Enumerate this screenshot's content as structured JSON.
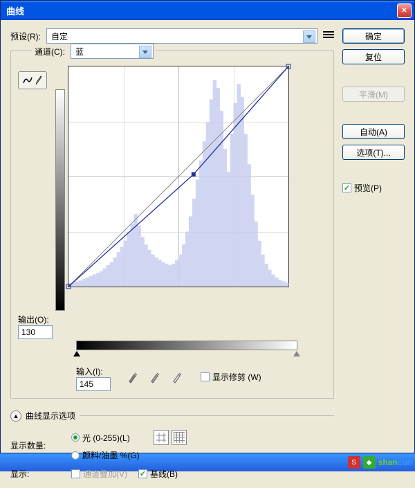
{
  "title": "曲线",
  "preset": {
    "label": "预设(R):",
    "value": "自定"
  },
  "channel": {
    "label": "通道(C):",
    "value": "蓝"
  },
  "output": {
    "label": "输出(O):",
    "value": "130"
  },
  "input": {
    "label": "输入(I):",
    "value": "145"
  },
  "show_clipping": {
    "label": "显示修剪 (W)",
    "checked": false
  },
  "display_options_header": "曲线显示选项",
  "show_amount": {
    "label": "显示数量:",
    "light": {
      "label": "光 (0-255)(L)",
      "checked": true
    },
    "pigment": {
      "label": "颜料/油墨 %(G)",
      "checked": false
    }
  },
  "show_row": {
    "label": "显示:",
    "channel_overlay": {
      "label": "通道叠加(V)",
      "checked": false,
      "disabled": true
    },
    "baseline": {
      "label": "基线(B)",
      "checked": true
    }
  },
  "buttons": {
    "ok": "确定",
    "reset": "复位",
    "smooth": "平滑(M)",
    "auto": "自动(A)",
    "options": "选项(T)..."
  },
  "preview": {
    "label": "预览(P)",
    "checked": true
  },
  "curve_point": {
    "input": 145,
    "output": 130
  },
  "watermark": "shancun",
  "chart_data": {
    "type": "line",
    "title": "",
    "xlabel": "输入",
    "ylabel": "输出",
    "xlim": [
      0,
      255
    ],
    "ylim": [
      0,
      255
    ],
    "series": [
      {
        "name": "baseline",
        "x": [
          0,
          255
        ],
        "y": [
          0,
          255
        ]
      },
      {
        "name": "curve",
        "x": [
          0,
          145,
          255
        ],
        "y": [
          0,
          130,
          255
        ]
      }
    ],
    "histogram": [
      5,
      6,
      7,
      8,
      10,
      12,
      14,
      16,
      18,
      20,
      24,
      28,
      32,
      38,
      45,
      52,
      60,
      70,
      82,
      95,
      80,
      65,
      55,
      48,
      42,
      38,
      35,
      32,
      30,
      28,
      30,
      35,
      42,
      55,
      72,
      92,
      115,
      140,
      165,
      190,
      215,
      245,
      270,
      260,
      230,
      180,
      150,
      200,
      240,
      265,
      248,
      200,
      160,
      120,
      85,
      60,
      42,
      30,
      22,
      16,
      12,
      9,
      7,
      5
    ]
  }
}
